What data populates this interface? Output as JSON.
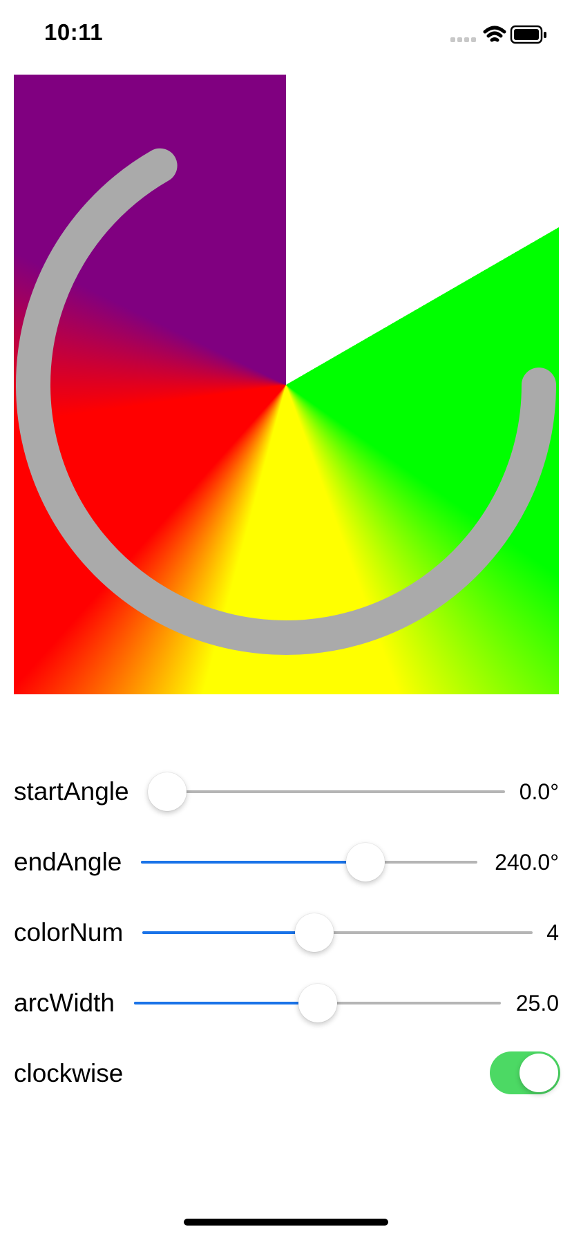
{
  "status_bar": {
    "time": "10:11",
    "icons": [
      "signal-icon",
      "wifi-icon",
      "battery-icon"
    ]
  },
  "gradient_view": {
    "colors": [
      "#ff0000",
      "#ffff00",
      "#00ff00",
      "#800080"
    ],
    "arc_color": "#aaaaaa",
    "start_angle": 0.0,
    "end_angle": 240.0,
    "color_num": 4,
    "arc_width": 25.0,
    "clockwise": true
  },
  "controls": {
    "start_angle": {
      "label": "startAngle",
      "value_text": "0.0°",
      "fraction": 0.0
    },
    "end_angle": {
      "label": "endAngle",
      "value_text": "240.0°",
      "fraction": 0.667
    },
    "color_num": {
      "label": "colorNum",
      "value_text": "4",
      "fraction": 0.44
    },
    "arc_width": {
      "label": "arcWidth",
      "value_text": "25.0",
      "fraction": 0.5
    },
    "clockwise": {
      "label": "clockwise",
      "on": true
    }
  }
}
